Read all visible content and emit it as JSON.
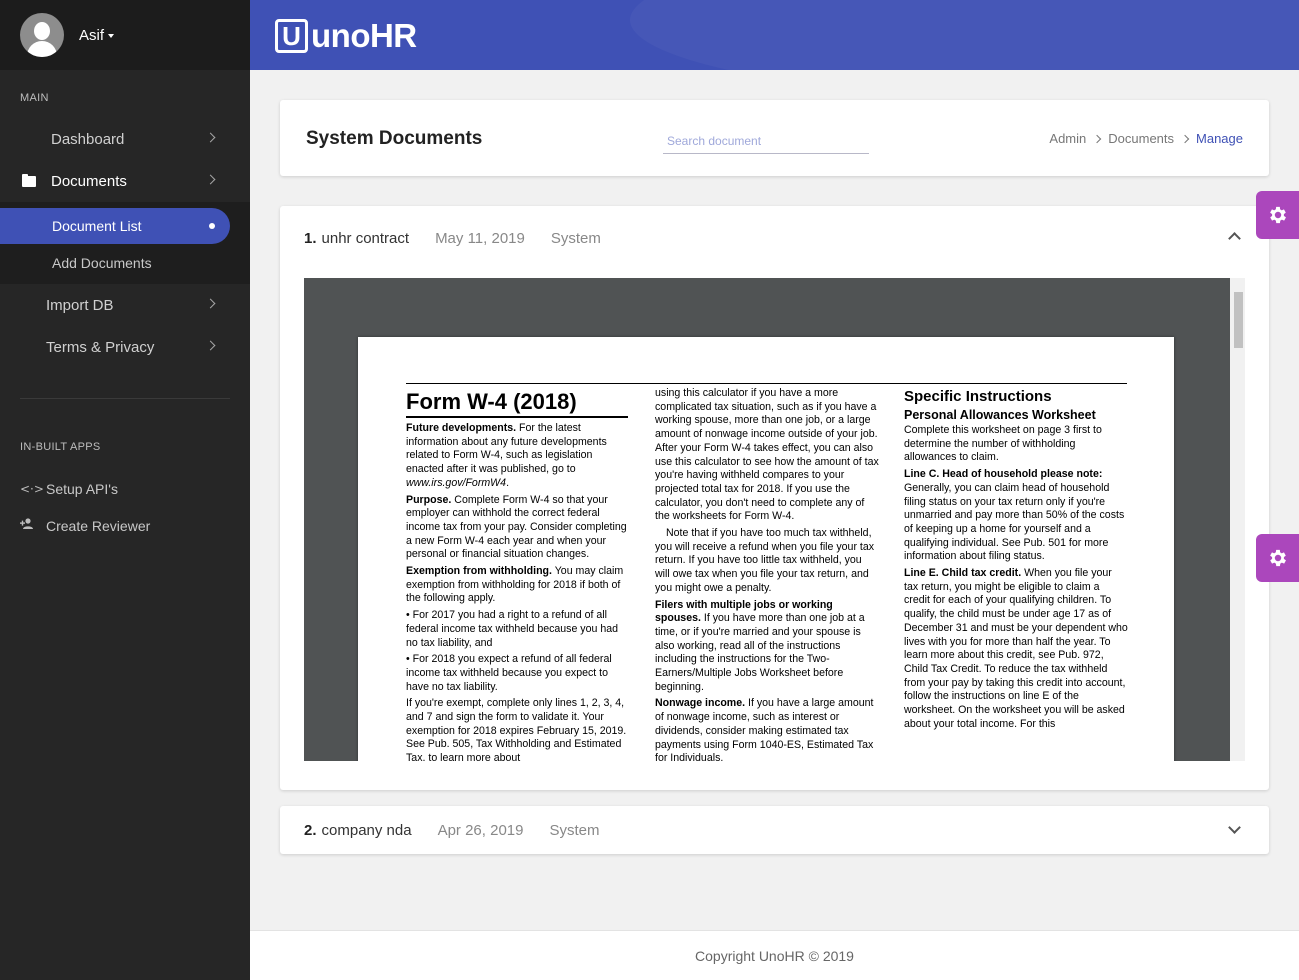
{
  "user": {
    "name": "Asif"
  },
  "sidebar": {
    "main_label": "MAIN",
    "items": [
      {
        "label": "Dashboard"
      },
      {
        "label": "Documents"
      },
      {
        "label": "Import DB"
      },
      {
        "label": "Terms & Privacy"
      }
    ],
    "documents_sub": [
      {
        "label": "Document List"
      },
      {
        "label": "Add Documents"
      }
    ],
    "apps_label": "IN-BUILT APPS",
    "apps": [
      {
        "label": "Setup API's",
        "icon": "code-arrows-icon"
      },
      {
        "label": "Create Reviewer",
        "icon": "add-person-icon"
      }
    ]
  },
  "header": {
    "logo_letter": "U",
    "logo_text": "unoHR"
  },
  "page": {
    "title": "System Documents",
    "search_placeholder": "Search document",
    "breadcrumb": [
      "Admin",
      "Documents",
      "Manage"
    ]
  },
  "documents": [
    {
      "num": "1.",
      "title": "unhr contract",
      "date": "May 11, 2019",
      "source": "System",
      "expanded": true
    },
    {
      "num": "2.",
      "title": "company nda",
      "date": "Apr 26, 2019",
      "source": "System",
      "expanded": false
    }
  ],
  "pdf": {
    "form_title": "Form W-4 (2018)",
    "col1": [
      {
        "b": "Future developments.",
        "t": " For the latest information about any future developments related to Form W-4, such as legislation enacted after it was published, go to ",
        "i": "www.irs.gov/FormW4",
        "e": "."
      },
      {
        "b": "Purpose.",
        "t": " Complete Form W-4 so that your employer can withhold the correct federal income tax from your pay. Consider completing a new Form W-4 each year and when your personal or financial situation changes."
      },
      {
        "b": "Exemption from withholding.",
        "t": " You may claim exemption from withholding for 2018 if both of the following apply."
      },
      {
        "b": "",
        "t": "• For 2017 you had a right to a refund of all federal income tax withheld because you had no tax liability, and"
      },
      {
        "b": "",
        "t": "• For 2018 you expect a refund of all federal income tax withheld because you expect to have no tax liability."
      },
      {
        "b": "",
        "t": "If you're exempt, complete only lines 1, 2, 3, 4, and 7 and sign the form to validate it. Your exemption for 2018 expires February 15, 2019. See Pub. 505, Tax Withholding and Estimated Tax, to learn more about"
      }
    ],
    "col2": [
      {
        "b": "",
        "t": "using this calculator if you have a more complicated tax situation, such as if you have a working spouse, more than one job, or a large amount of nonwage income outside of your job.  After your Form W-4 takes effect, you can also use this calculator to see how the amount of tax you're having withheld compares to your projected total tax for 2018. If you use the calculator, you don't need to complete any of the worksheets for Form W-4."
      },
      {
        "b": "",
        "t": "Note that if you have too much tax withheld, you will receive a refund when you file your tax return. If you have too little tax withheld, you will owe tax when you file your tax return, and you might owe a penalty.",
        "indent": true
      },
      {
        "b": "Filers with multiple jobs or working spouses.",
        "t": " If you have more than one job at a time, or if you're married and your spouse is also working, read all of the instructions including the instructions for the Two-Earners/Multiple Jobs Worksheet before beginning."
      },
      {
        "b": "Nonwage income.",
        "t": " If you have a large amount of nonwage income, such as interest or dividends, consider making estimated tax payments using Form 1040-ES, Estimated Tax for Individuals."
      }
    ],
    "col3_h1": "Specific Instructions",
    "col3_h2": "Personal Allowances Worksheet",
    "col3": [
      {
        "b": "",
        "t": "Complete this worksheet on page 3 first to determine the number of withholding allowances to claim."
      },
      {
        "b": "Line C. Head of household please note:",
        "t": " Generally, you can claim head of household filing status on your tax return only if you're unmarried and pay more than 50% of the costs of keeping up a home for yourself and a qualifying individual. See Pub. 501 for more information about filing status."
      },
      {
        "b": "Line E. Child tax credit.",
        "t": " When you file your tax return, you might be eligible to claim a credit for each of your qualifying children. To qualify, the child must be under age 17 as of December 31 and must be your dependent who lives with you for more than half the year. To learn more about this credit, see Pub. 972, Child Tax Credit. To reduce the tax withheld from your pay by taking this credit into account, follow the instructions on line E of the worksheet. On the worksheet you will be asked about your total income. For this"
      }
    ]
  },
  "footer": {
    "text": "Copyright UnoHR © 2019"
  },
  "colors": {
    "primary": "#3f51b5",
    "accent": "#ab47bc",
    "sidebar": "#262626"
  }
}
